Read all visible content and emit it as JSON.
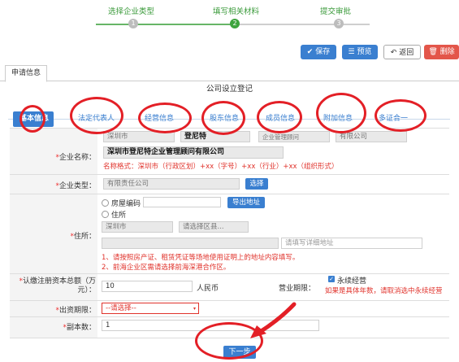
{
  "steps": [
    {
      "label": "选择企业类型",
      "num": "1"
    },
    {
      "label": "填写相关材料",
      "num": "2"
    },
    {
      "label": "提交审批",
      "num": "3"
    }
  ],
  "toolbar": {
    "save": "保存",
    "preview": "预览",
    "back": "返回",
    "delete": "删除"
  },
  "tab": "申请信息",
  "form_title": "公司设立登记",
  "substeps": [
    "基本信息",
    "法定代表人",
    "经营信息",
    "股东信息",
    "成员信息",
    "附加信息",
    "多证合一"
  ],
  "company_name": {
    "label": "企业名称：",
    "parts": [
      "深圳市",
      "登尼特",
      "企业管理顾问",
      "有限公司"
    ],
    "full": "深圳市登尼特企业管理顾问有限公司",
    "format_hint": "名称格式：深圳市（行政区划）+xx（字号）+xx（行业）+xx（组织形式）"
  },
  "company_type": {
    "label": "企业类型：",
    "value": "有限责任公司",
    "select_button": "选择"
  },
  "address": {
    "label": "住所：",
    "option_house_code": "房屋编码",
    "export_button": "导出地址",
    "option_residence": "住所",
    "city": "深圳市",
    "district_placeholder": "请选择区县...",
    "detail_placeholder": "请填写详细地址",
    "note1": "1、请按照房产证、租赁凭证等场地使用证明上的地址内容填写。",
    "note2": "2、前海企业区需请选择前海深港合作区。"
  },
  "capital": {
    "label": "认缴注册资本总额（万元）：",
    "value": "10",
    "unit": "人民币"
  },
  "business_term": {
    "label": "营业期限：",
    "checkbox_label": "永续经营",
    "hint": "如果是具体年数，请取消选中永续经营"
  },
  "contribution_term": {
    "label": "出资期限：",
    "value": "--请选择--"
  },
  "copies": {
    "label": "副本数：",
    "value": "1"
  },
  "next_button": "下一步"
}
